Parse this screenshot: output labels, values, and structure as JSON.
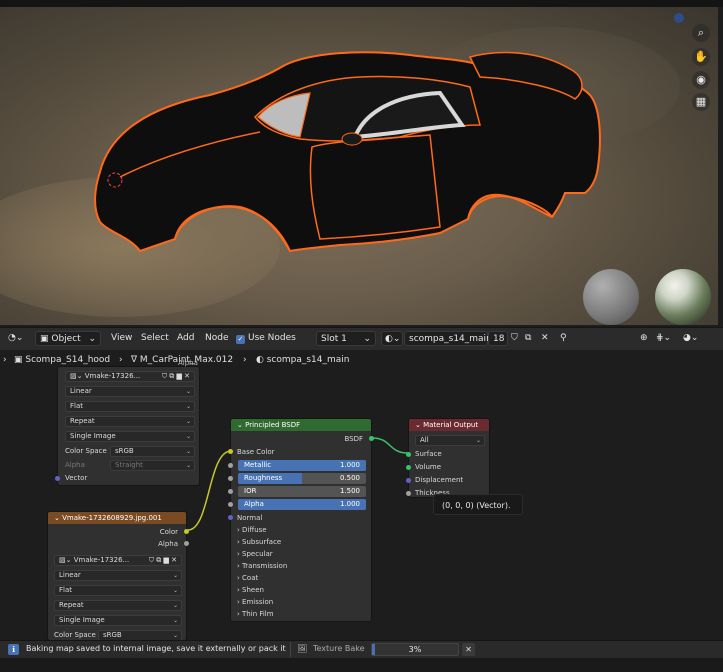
{
  "viewport": {
    "nav_icons": [
      "zoom-icon",
      "hand-pan-icon",
      "camera-icon",
      "grid-icon"
    ]
  },
  "header": {
    "editor_type_icon": "node-editor-icon",
    "mode": "Object",
    "menus": [
      "View",
      "Select",
      "Add",
      "Node"
    ],
    "use_nodes_label": "Use Nodes",
    "use_nodes_checked": true,
    "slot": "Slot 1",
    "material_name": "scompa_s14_main",
    "user_count": "18",
    "accent": "#4772b3"
  },
  "breadcrumb": {
    "object": "Scompa_S14_hood",
    "modifier": "M_CarPaint_Max.012",
    "material": "scompa_s14_main"
  },
  "node_top": {
    "image_name": "Vmake-17326...",
    "top_clip": "Alpha",
    "interpolation": "Linear",
    "projection": "Flat",
    "extension": "Repeat",
    "source": "Single Image",
    "color_space_label": "Color Space",
    "color_space": "sRGB",
    "alpha_label": "Alpha",
    "alpha_mode": "Straight",
    "vector_label": "Vector"
  },
  "node_image": {
    "title": "Vmake-1732608929.jpg.001",
    "header_color": "#7a4b23",
    "out_color": "Color",
    "out_alpha": "Alpha",
    "image_name": "Vmake-17326...",
    "interpolation": "Linear",
    "projection": "Flat",
    "extension": "Repeat",
    "source": "Single Image",
    "color_space_label": "Color Space",
    "color_space": "sRGB"
  },
  "node_bsdf": {
    "title": "Principled BSDF",
    "header_color": "#2f6a30",
    "out_bsdf": "BSDF",
    "base_color": "Base Color",
    "fields": [
      {
        "label": "Metallic",
        "value": "1.000",
        "fill": 1.0
      },
      {
        "label": "Roughness",
        "value": "0.500",
        "fill": 0.5
      },
      {
        "label": "IOR",
        "value": "1.500",
        "fill": 0.0
      },
      {
        "label": "Alpha",
        "value": "1.000",
        "fill": 1.0
      }
    ],
    "normal": "Normal",
    "panels": [
      "Diffuse",
      "Subsurface",
      "Specular",
      "Transmission",
      "Coat",
      "Sheen",
      "Emission",
      "Thin Film"
    ]
  },
  "node_output": {
    "title": "Material Output",
    "header_color": "#6b2a30",
    "target": "All",
    "inputs": [
      "Surface",
      "Volume",
      "Displacement",
      "Thickness"
    ]
  },
  "tooltip": "(0, 0, 0) (Vector).",
  "status": {
    "message": "Baking map saved to internal image, save it externally or pack it",
    "job": "Texture Bake",
    "progress_text": "3%",
    "progress": 0.03
  }
}
